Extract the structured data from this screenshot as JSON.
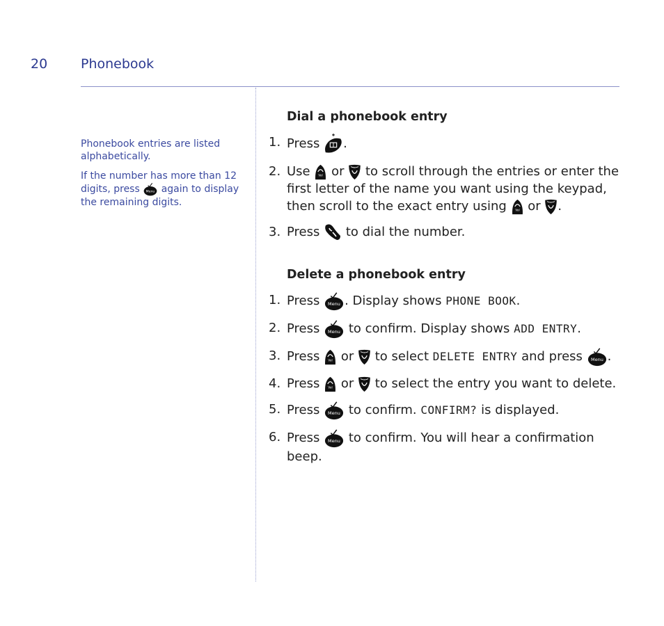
{
  "header": {
    "page_number": "20",
    "section_title": "Phonebook"
  },
  "sidebar": {
    "note1": "Phonebook entries are listed alphabetically.",
    "note2_a": "If the number has more than 12 digits, press",
    "note2_b": "again to display the remaining digits."
  },
  "dial": {
    "heading": "Dial a phonebook entry",
    "steps": [
      {
        "num": "1.",
        "a": "Press",
        "b": "."
      },
      {
        "num": "2.",
        "a": "Use",
        "or": "or",
        "b": "to scroll through the entries or enter the first letter of the name you want using the keypad, then scroll to the exact entry using",
        "or2": "or",
        "c": "."
      },
      {
        "num": "3.",
        "a": "Press",
        "b": "to dial the number."
      }
    ]
  },
  "delete": {
    "heading": "Delete a phonebook entry",
    "steps": [
      {
        "num": "1.",
        "a": "Press",
        "b": ". Display shows",
        "lcd": "PHONE BOOK",
        "c": "."
      },
      {
        "num": "2.",
        "a": "Press",
        "b": "to confirm. Display shows",
        "lcd": "ADD ENTRY",
        "c": "."
      },
      {
        "num": "3.",
        "a": "Press",
        "or": "or",
        "b": "to select",
        "lcd": "DELETE ENTRY",
        "c": "and press",
        "d": "."
      },
      {
        "num": "4.",
        "a": "Press",
        "or": "or",
        "b": "to select the entry you want to delete."
      },
      {
        "num": "5.",
        "a": "Press",
        "b": "to confirm.",
        "lcd": "CONFIRM?",
        "c": "is displayed."
      },
      {
        "num": "6.",
        "a": "Press",
        "b": "to confirm. You will hear a confirmation beep."
      }
    ]
  },
  "icons": {
    "menu_label": "Menu",
    "vol_label": "Vol"
  }
}
